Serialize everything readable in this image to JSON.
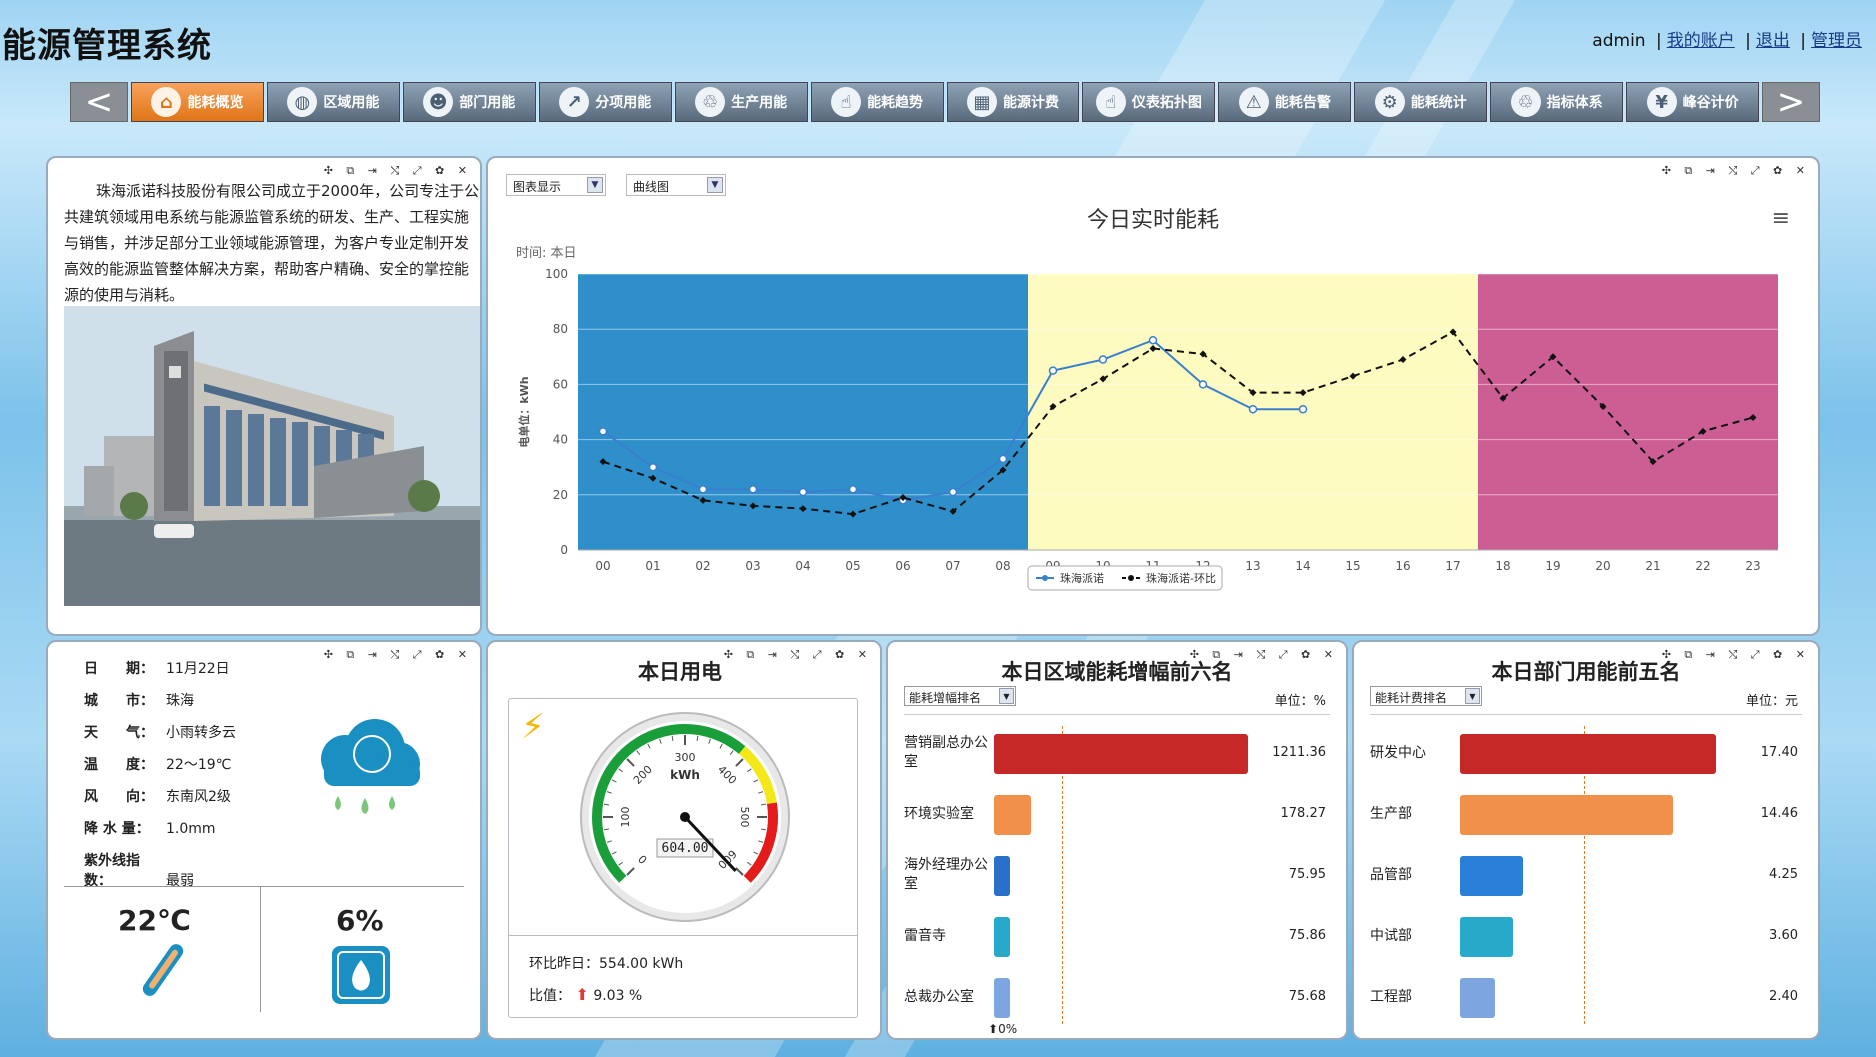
{
  "header": {
    "title": "能源管理系统",
    "user": "admin",
    "links": [
      "我的账户",
      "退出",
      "管理员"
    ]
  },
  "nav": {
    "prev": "<",
    "next": ">",
    "items": [
      {
        "label": "能耗概览",
        "icon": "house-icon",
        "active": true
      },
      {
        "label": "区域用能",
        "icon": "globe-icon",
        "active": false
      },
      {
        "label": "部门用能",
        "icon": "people-icon",
        "active": false
      },
      {
        "label": "分项用能",
        "icon": "trend-icon",
        "active": false
      },
      {
        "label": "生产用能",
        "icon": "recycle-icon",
        "active": false
      },
      {
        "label": "能耗趋势",
        "icon": "foot-icon",
        "active": false
      },
      {
        "label": "能源计费",
        "icon": "calculator-icon",
        "active": false
      },
      {
        "label": "仪表拓扑图",
        "icon": "foot-icon",
        "active": false
      },
      {
        "label": "能耗告警",
        "icon": "warning-icon",
        "active": false
      },
      {
        "label": "能耗统计",
        "icon": "gears-icon",
        "active": false
      },
      {
        "label": "指标体系",
        "icon": "recycle-icon",
        "active": false
      },
      {
        "label": "峰谷计价",
        "icon": "money-icon",
        "active": false
      }
    ]
  },
  "intro": {
    "text": "珠海派诺科技股份有限公司成立于2000年，公司专注于公共建筑领域用电系统与能源监管系统的研发、生产、工程实施与销售，并涉足部分工业领域能源管理，为客户专业定制开发高效的能源监管整体解决方案，帮助客户精确、安全的掌控能源的使用与消耗。"
  },
  "panel_tools": "✣ ⧉ ⇥ ⤭ ⤢ ✿ ✕",
  "chart_panel": {
    "display_select": "图表显示",
    "type_select": "曲线图",
    "menu_icon": "≡"
  },
  "chart_data": {
    "type": "line",
    "title": "今日实时能耗",
    "subtitle": "时间: 本日",
    "ylabel": "电单位：kWh",
    "ylim": [
      0,
      100
    ],
    "yticks": [
      0,
      20,
      40,
      60,
      80,
      100
    ],
    "categories": [
      "00",
      "01",
      "02",
      "03",
      "04",
      "05",
      "06",
      "07",
      "08",
      "09",
      "10",
      "11",
      "12",
      "13",
      "14",
      "15",
      "16",
      "17",
      "18",
      "19",
      "20",
      "21",
      "22",
      "23"
    ],
    "bands": [
      {
        "from": 0,
        "to": 9,
        "color": "#2f8fcb"
      },
      {
        "from": 9,
        "to": 18,
        "color": "#fdfbc0"
      },
      {
        "from": 18,
        "to": 24,
        "color": "#cd5e93"
      }
    ],
    "series": [
      {
        "name": "珠海派诺",
        "color": "#3a7fcf",
        "dash": false,
        "values": [
          43,
          30,
          22,
          22,
          21,
          22,
          18,
          21,
          33,
          65,
          69,
          76,
          60,
          51,
          51,
          null,
          null,
          null,
          null,
          null,
          null,
          null,
          null,
          null
        ]
      },
      {
        "name": "珠海派诺-环比",
        "color": "#111111",
        "dash": true,
        "values": [
          32,
          26,
          18,
          16,
          15,
          13,
          19,
          14,
          29,
          52,
          62,
          73,
          71,
          57,
          57,
          63,
          69,
          79,
          55,
          70,
          52,
          32,
          43,
          48
        ]
      }
    ]
  },
  "weather": {
    "rows": [
      {
        "k": "日　　期：",
        "v": "11月22日"
      },
      {
        "k": "城　　市：",
        "v": "珠海"
      },
      {
        "k": "天　　气：",
        "v": "小雨转多云"
      },
      {
        "k": "温　　度：",
        "v": "22～19℃"
      },
      {
        "k": "风　　向：",
        "v": "东南风2级"
      },
      {
        "k": "降 水 量：",
        "v": "1.0mm"
      },
      {
        "k": "紫外线指数：",
        "v": "最弱"
      }
    ],
    "temperature": "22℃",
    "humidity": "6%"
  },
  "electricity": {
    "title": "本日用电",
    "gauge_value": 604.0,
    "gauge_display": "604.00",
    "gauge_unit": "kWh",
    "gauge_min": 0,
    "gauge_max": 600,
    "gauge_ticks": [
      "0",
      "100",
      "200",
      "300",
      "400",
      "500",
      "600"
    ],
    "yesterday": "环比昨日：554.00 kWh",
    "ratio_label": "比值：",
    "ratio_value": "9.03 %"
  },
  "region_rank": {
    "title": "本日区域能耗增幅前六名",
    "select": "能耗增幅排名",
    "unit": "单位：%",
    "axis_note": "0%",
    "items": [
      {
        "label": "营销副总办公室",
        "value": "1211.36",
        "num": 1211.36,
        "color": "#c62828"
      },
      {
        "label": "环境实验室",
        "value": "178.27",
        "num": 178.27,
        "color": "#f0904a"
      },
      {
        "label": "海外经理办公室",
        "value": "75.95",
        "num": 75.95,
        "color": "#2a6fc9"
      },
      {
        "label": "雷音寺",
        "value": "75.86",
        "num": 75.86,
        "color": "#27a9c9"
      },
      {
        "label": "总裁办公室",
        "value": "75.68",
        "num": 75.68,
        "color": "#7da6e0"
      }
    ]
  },
  "dept_rank": {
    "title": "本日部门用能前五名",
    "select": "能耗计费排名",
    "unit": "单位：元",
    "items": [
      {
        "label": "研发中心",
        "value": "17.40",
        "num": 17.4,
        "color": "#c62828"
      },
      {
        "label": "生产部",
        "value": "14.46",
        "num": 14.46,
        "color": "#f0904a"
      },
      {
        "label": "品管部",
        "value": "4.25",
        "num": 4.25,
        "color": "#2a7fd8"
      },
      {
        "label": "中试部",
        "value": "3.60",
        "num": 3.6,
        "color": "#27a9c9"
      },
      {
        "label": "工程部",
        "value": "2.40",
        "num": 2.4,
        "color": "#7da6e0"
      }
    ]
  }
}
